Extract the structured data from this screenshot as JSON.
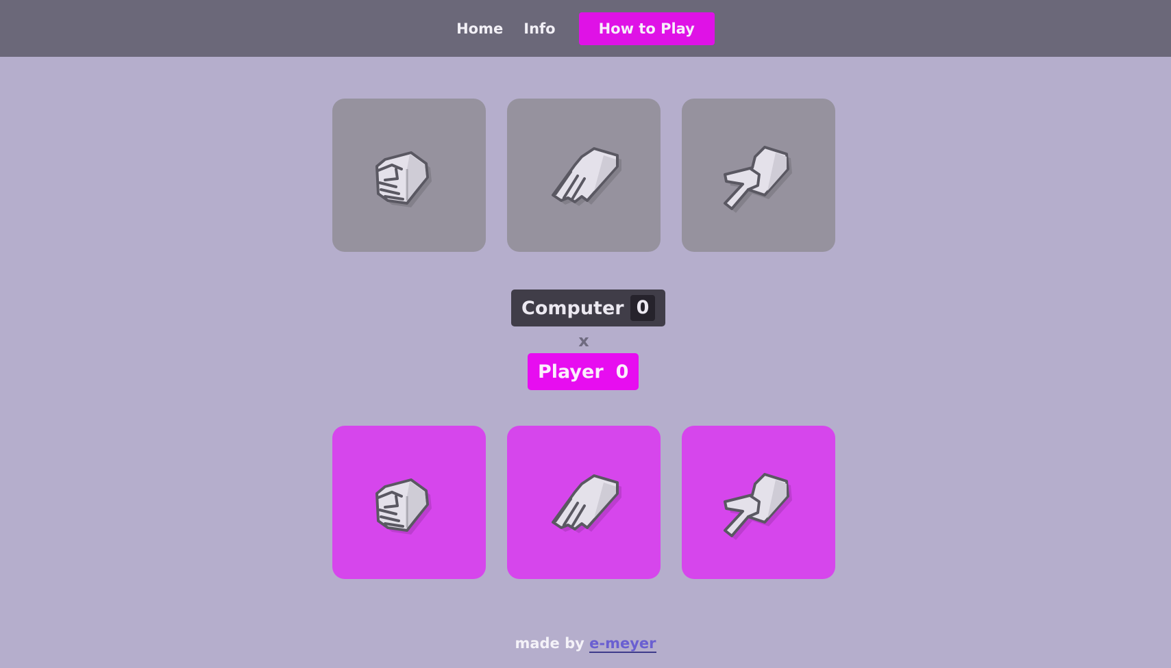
{
  "nav": {
    "links": [
      "Home",
      "Info"
    ],
    "cta": "How to Play"
  },
  "choices": [
    "rock",
    "paper",
    "scissors"
  ],
  "scoreboard": {
    "computer_label": "Computer",
    "computer_score": "0",
    "versus": "x",
    "player_label": "Player",
    "player_score": "0"
  },
  "footer": {
    "text": "made by",
    "link": "e-meyer"
  },
  "colors": {
    "background": "#b5aecc",
    "navbar": "#6b6879",
    "accent": "#df12e6",
    "computer_card": "#96929e",
    "player_card": "#d646ec",
    "computer_badge": "#403d48"
  },
  "icons": [
    "rock-hand-icon",
    "paper-hand-icon",
    "scissors-hand-icon"
  ]
}
